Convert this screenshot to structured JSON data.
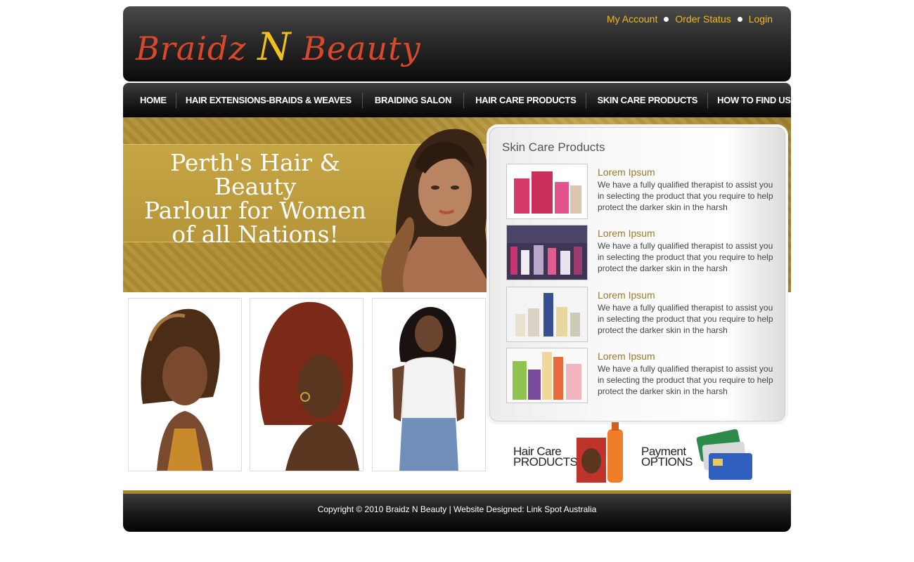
{
  "header": {
    "logo_left": "Braidz ",
    "logo_n": "N",
    "logo_right": " Beauty",
    "links": [
      "My Account",
      "Order Status",
      "Login"
    ]
  },
  "nav": {
    "items": [
      "HOME",
      "HAIR EXTENSIONS-BRAIDS & WEAVES",
      "BRAIDING SALON",
      "HAIR CARE PRODUCTS",
      "SKIN CARE PRODUCTS",
      "HOW TO FIND US..."
    ]
  },
  "banner": {
    "line1": "Perth's Hair & Beauty",
    "line2": "Parlour for Women",
    "line3": "of all Nations!"
  },
  "skin_care": {
    "title": "Skin Care Products",
    "products": [
      {
        "title": "Lorem Ipsum",
        "desc": "We have a fully qualified therapist to assist you in selecting the product that you require to help protect the darker skin in the harsh"
      },
      {
        "title": "Lorem Ipsum",
        "desc": "We have a fully qualified therapist to assist you in selecting the product that you require to help protect the darker skin in the harsh"
      },
      {
        "title": "Lorem Ipsum",
        "desc": "We have a fully qualified therapist to assist you in selecting the product that you require to help protect the darker skin in the harsh"
      },
      {
        "title": "Lorem Ipsum",
        "desc": "We have a fully qualified therapist to assist you in selecting the product that you require to help protect the darker skin in the harsh"
      }
    ]
  },
  "promos": {
    "hair_line1": "Hair Care",
    "hair_line2": "PRODUCTS",
    "pay_line1": "Payment",
    "pay_line2": "OPTIONS"
  },
  "footer": {
    "copyright": "Copyright © 2010  Braidz N Beauty | Website Designed: Link Spot Australia"
  },
  "colors": {
    "accent_gold": "#a3852c",
    "link_yellow": "#f3b81b",
    "logo_red": "#d9482b"
  }
}
